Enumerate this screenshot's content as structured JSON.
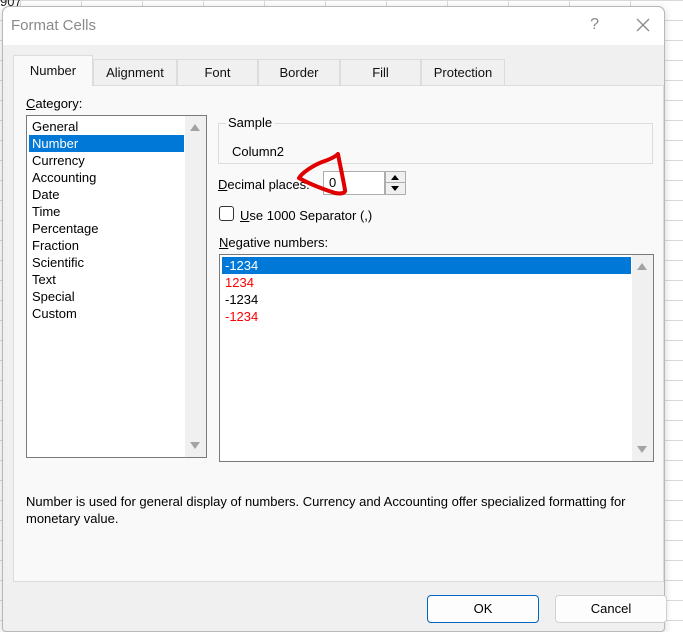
{
  "background": {
    "cell_fragment": "907"
  },
  "dialog": {
    "title": "Format Cells",
    "help_label": "?",
    "close_icon": "close-x-icon"
  },
  "tabs": [
    {
      "label": "Number",
      "active": true
    },
    {
      "label": "Alignment",
      "active": false
    },
    {
      "label": "Font",
      "active": false
    },
    {
      "label": "Border",
      "active": false
    },
    {
      "label": "Fill",
      "active": false
    },
    {
      "label": "Protection",
      "active": false
    }
  ],
  "category": {
    "label_prefix": "C",
    "label_rest": "ategory:",
    "items": [
      "General",
      "Number",
      "Currency",
      "Accounting",
      "Date",
      "Time",
      "Percentage",
      "Fraction",
      "Scientific",
      "Text",
      "Special",
      "Custom"
    ],
    "selected": "Number"
  },
  "sample": {
    "legend": "Sample",
    "value": "Column2"
  },
  "decimal_places": {
    "label_prefix": "D",
    "label_rest": "ecimal places:",
    "value": "0"
  },
  "separator": {
    "label_prefix": "U",
    "label_rest": "se 1000 Separator (,)",
    "checked": false
  },
  "negative_numbers": {
    "label_prefix": "N",
    "label_rest": "egative numbers:",
    "items": [
      {
        "text": "-1234",
        "color": "#000000",
        "selected": true
      },
      {
        "text": "1234",
        "color": "#ff0000",
        "selected": false
      },
      {
        "text": "-1234",
        "color": "#000000",
        "selected": false
      },
      {
        "text": "-1234",
        "color": "#ff0000",
        "selected": false
      }
    ]
  },
  "description": "Number is used for general display of numbers.  Currency and Accounting offer specialized formatting for monetary value.",
  "buttons": {
    "ok": "OK",
    "cancel": "Cancel"
  },
  "colors": {
    "accent": "#0078d7",
    "annotation": "#e00000",
    "negative_red": "#ff0000"
  }
}
